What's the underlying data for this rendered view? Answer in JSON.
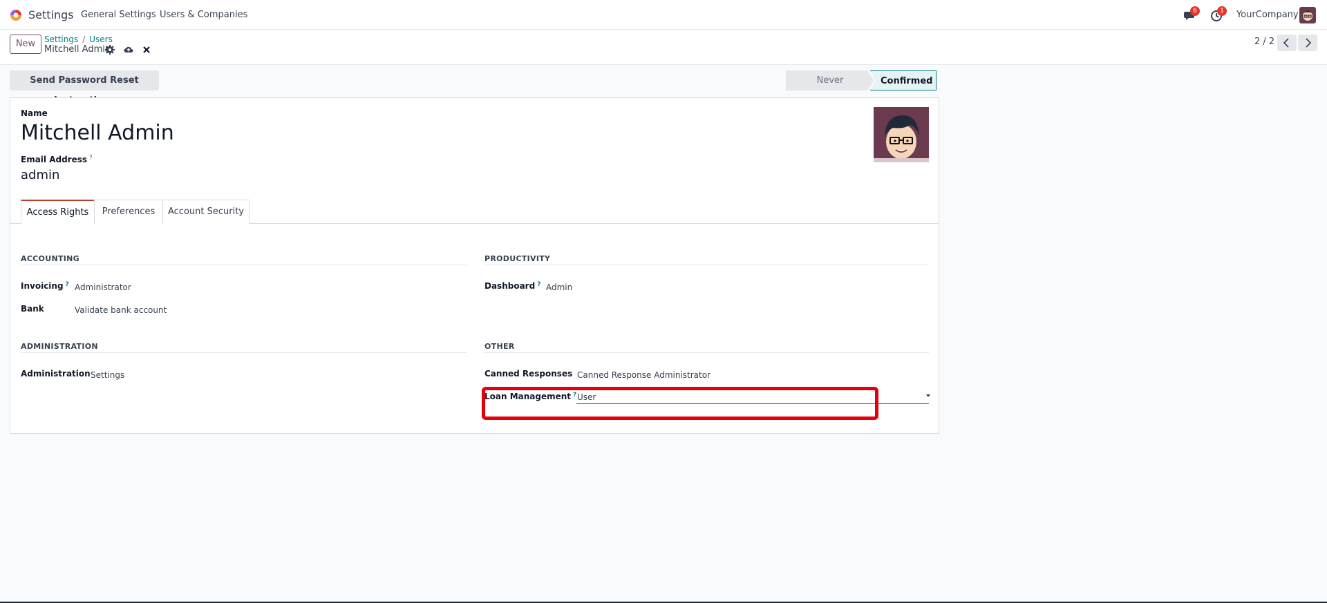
{
  "navbar": {
    "app_name": "Settings",
    "menu": [
      "General Settings",
      "Users & Companies"
    ],
    "messages_badge": "6",
    "activities_badge": "1",
    "company": "YourCompany"
  },
  "control_panel": {
    "new_label": "New",
    "breadcrumb": [
      "Settings",
      "Users"
    ],
    "record_name": "Mitchell Admin",
    "pager": "2 / 2"
  },
  "actions": {
    "reset_password_label": "Send Password Reset Instructions"
  },
  "status_bar": {
    "stages": [
      "Never Connected",
      "Confirmed"
    ],
    "active": "Confirmed"
  },
  "form": {
    "name_label": "Name",
    "name_value": "Mitchell Admin",
    "email_label": "Email Address",
    "email_value": "admin",
    "help_marker": "?"
  },
  "tabs": [
    "Access Rights",
    "Preferences",
    "Account Security"
  ],
  "access_rights": {
    "accounting": {
      "title": "ACCOUNTING",
      "fields": [
        {
          "label": "Invoicing",
          "value": "Administrator"
        },
        {
          "label": "Bank",
          "value": "Validate bank account"
        }
      ]
    },
    "productivity": {
      "title": "PRODUCTIVITY",
      "fields": [
        {
          "label": "Dashboard",
          "value": "Admin"
        }
      ]
    },
    "administration": {
      "title": "ADMINISTRATION",
      "fields": [
        {
          "label": "Administration",
          "value": "Settings"
        }
      ]
    },
    "other": {
      "title": "OTHER",
      "fields": [
        {
          "label": "Canned Responses",
          "value": "Canned Response Administrator"
        },
        {
          "label": "Loan Management",
          "value": "User"
        }
      ]
    }
  },
  "colors": {
    "brand": "#714b67",
    "link": "#017e84",
    "highlight": "#e3000b",
    "badge": "#e4382c"
  }
}
